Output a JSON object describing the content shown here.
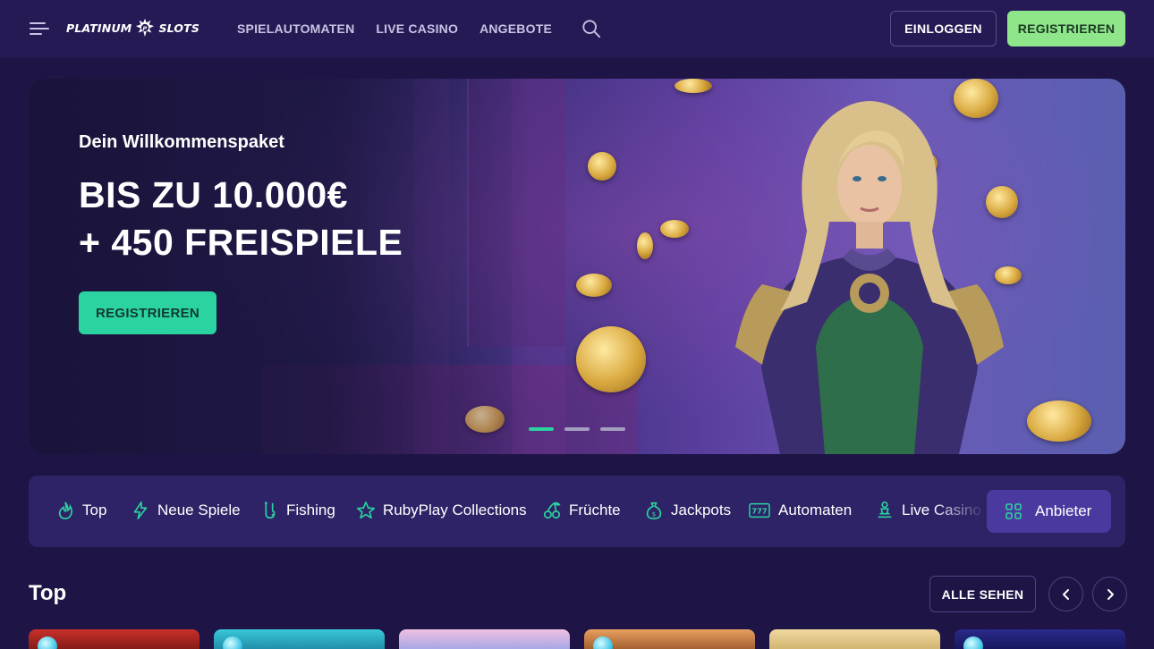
{
  "header": {
    "logo": "PLATINUM",
    "logo_suffix": "SLOTS",
    "nav": [
      "SPIELAUTOMATEN",
      "LIVE CASINO",
      "ANGEBOTE"
    ],
    "login_label": "EINLOGGEN",
    "register_label": "REGISTRIEREN"
  },
  "hero": {
    "subtitle": "Dein Willkommenspaket",
    "title_line1": "BIS ZU 10.000€",
    "title_line2": "+ 450 FREISPIELE",
    "cta": "REGISTRIEREN",
    "slides_total": 3,
    "active_slide": 1
  },
  "categories": [
    {
      "label": "Top",
      "icon": "flame-icon"
    },
    {
      "label": "Neue Spiele",
      "icon": "lightning-icon"
    },
    {
      "label": "Fishing",
      "icon": "fishhook-icon"
    },
    {
      "label": "RubyPlay Collections",
      "icon": "star-icon"
    },
    {
      "label": "Früchte",
      "icon": "cherry-icon"
    },
    {
      "label": "Jackpots",
      "icon": "moneybag-icon"
    },
    {
      "label": "Automaten",
      "icon": "777-icon"
    },
    {
      "label": "Live Casino",
      "icon": "dealer-icon"
    }
  ],
  "providers_label": "Anbieter",
  "section": {
    "title": "Top",
    "see_all": "ALLE SEHEN"
  },
  "colors": {
    "accent_green": "#8ee58a",
    "accent_teal": "#2bd3a0",
    "background": "#1e1546",
    "header_bg": "#261a55"
  }
}
